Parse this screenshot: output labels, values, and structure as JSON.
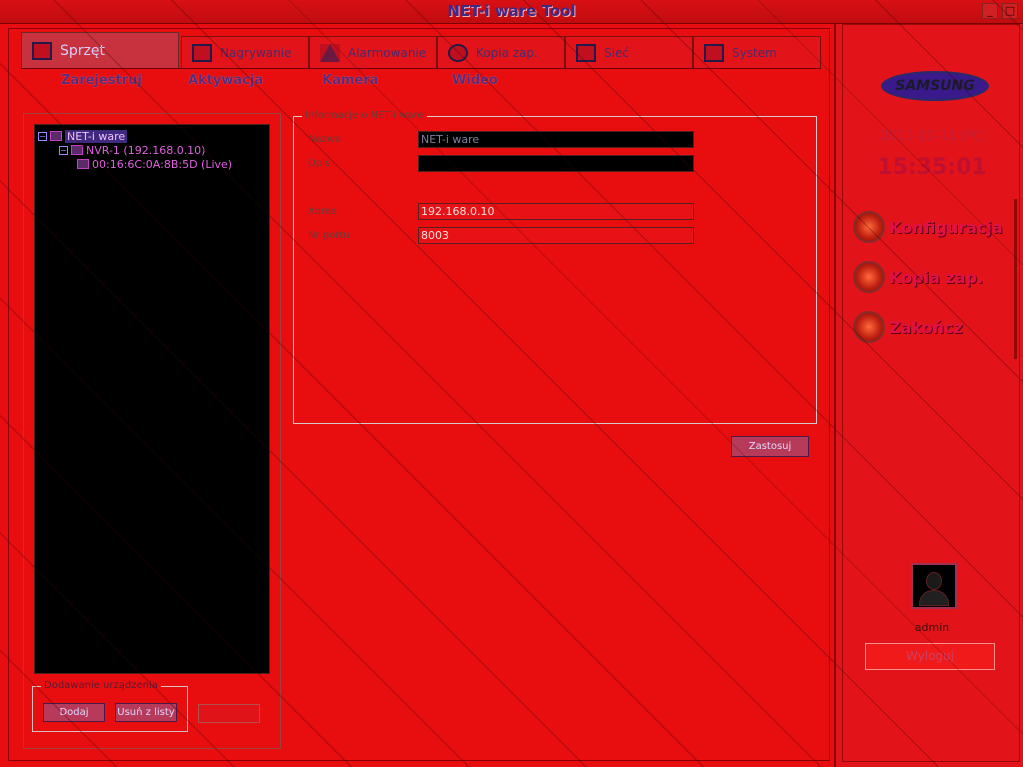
{
  "window": {
    "title": "NET-i ware Tool",
    "minimize_glyph": "_",
    "maximize_glyph": "□"
  },
  "tabs": [
    {
      "label": "Sprzęt",
      "icon": "hardware-icon"
    },
    {
      "label": "Nagrywanie",
      "icon": "recording-icon"
    },
    {
      "label": "Alarmowanie",
      "icon": "alarm-icon"
    },
    {
      "label": "Kopia zap.",
      "icon": "backup-icon"
    },
    {
      "label": "Sieć",
      "icon": "network-icon"
    },
    {
      "label": "System",
      "icon": "system-icon"
    }
  ],
  "subtabs": [
    "Zarejestruj",
    "Aktywacja",
    "Kamera",
    "Wideo"
  ],
  "tree": {
    "root": "NET-i ware",
    "child": "NVR-1 (192.168.0.10)",
    "grandchild": "00:16:6C:0A:8B:5D (Live)"
  },
  "group_box": {
    "title": "Dodawanie urządzenia",
    "buttons": [
      "Dodaj",
      "Usuń z listy",
      "Usuń"
    ]
  },
  "info": {
    "title": "Informacje o NET-i ware",
    "fields": [
      {
        "label": "Nazwa",
        "value": "NET-i ware"
      },
      {
        "label": "Opis",
        "value": ""
      },
      {
        "label": "Adres",
        "value": "192.168.0.10"
      },
      {
        "label": "Nr portu",
        "value": "8003"
      }
    ],
    "apply_button": "Zastosuj"
  },
  "sidebar": {
    "logo_text": "SAMSUNG",
    "date": "2011-11-11 (Pt)",
    "time": "15:35:01",
    "menu": [
      {
        "label": "Konfiguracja",
        "icon": "config-gear-icon"
      },
      {
        "label": "Kopia zap.",
        "icon": "backup-icon"
      },
      {
        "label": "Zakończ",
        "icon": "power-icon"
      }
    ],
    "user": "admin",
    "logout_label": "Wyloguj"
  },
  "colors": {
    "background": "#e80e10",
    "tree_background": "#000000",
    "accent": "#3a1a8a"
  }
}
